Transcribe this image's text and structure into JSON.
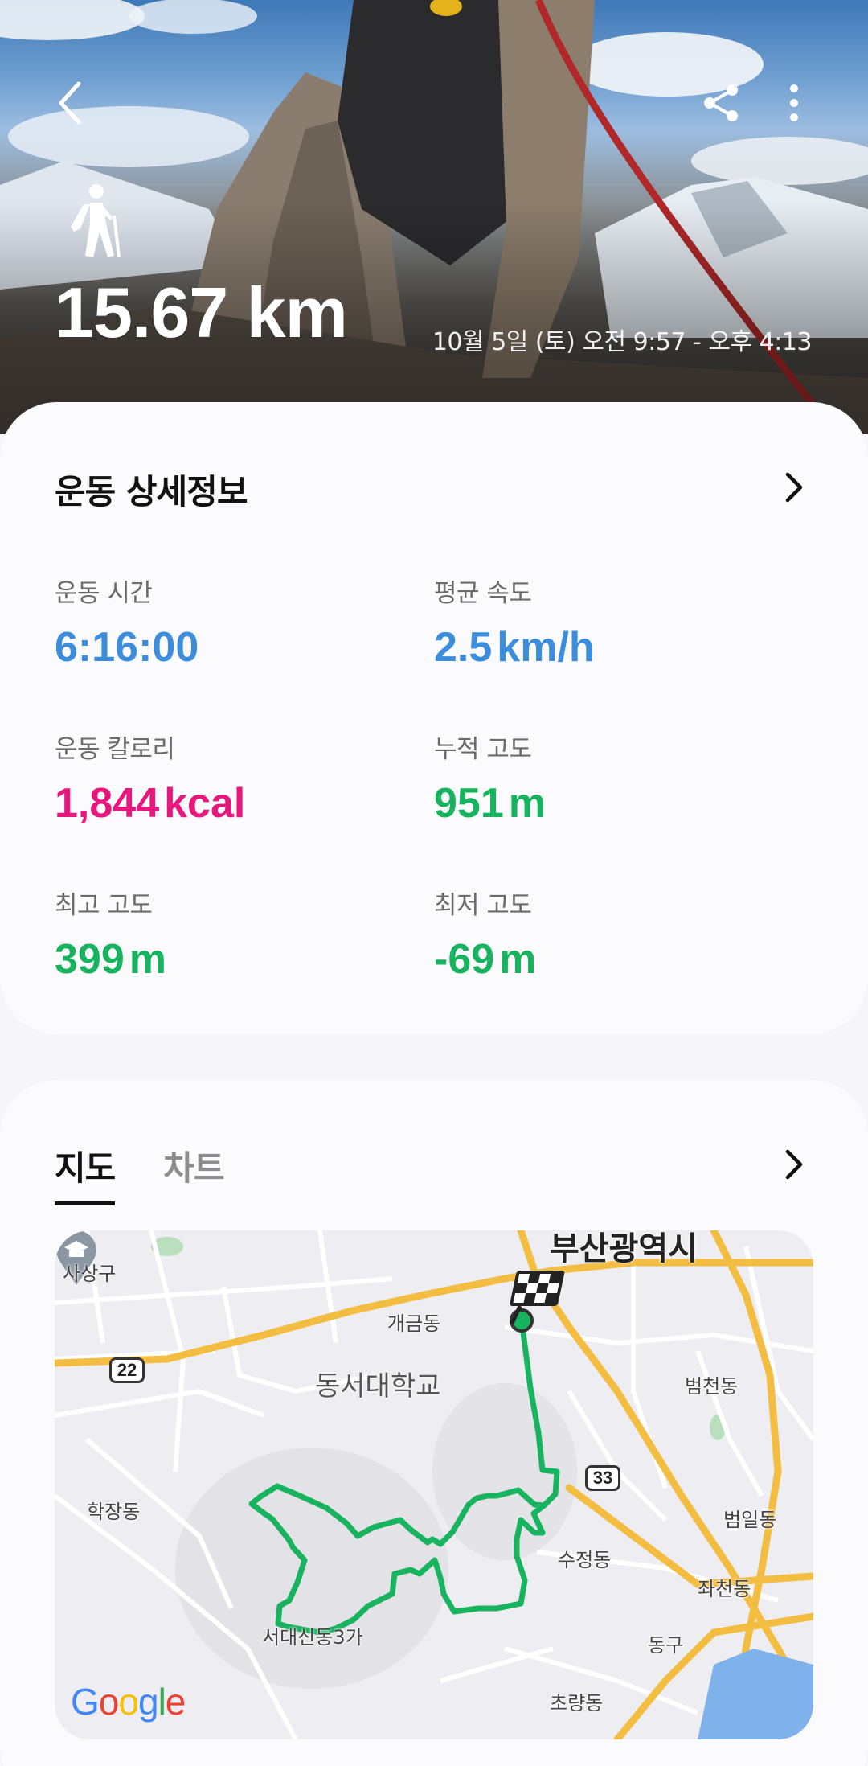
{
  "header": {
    "back_icon": "chevron-left-icon",
    "share_icon": "share-icon",
    "more_icon": "more-vertical-icon",
    "activity_icon": "hiking-icon",
    "distance": "15.67 km",
    "date_range": "10월 5일 (토) 오전 9:57 - 오후 4:13"
  },
  "details": {
    "title": "운동 상세정보",
    "stats": [
      {
        "label": "운동 시간",
        "value": "6:16:00",
        "unit": "",
        "color": "#3d8ddd"
      },
      {
        "label": "평균 속도",
        "value": "2.5",
        "unit": "km/h",
        "color": "#3d8ddd"
      },
      {
        "label": "운동 칼로리",
        "value": "1,844",
        "unit": "kcal",
        "color": "#e8177e"
      },
      {
        "label": "누적 고도",
        "value": "951",
        "unit": "m",
        "color": "#18b35f"
      },
      {
        "label": "최고 고도",
        "value": "399",
        "unit": "m",
        "color": "#18b35f"
      },
      {
        "label": "최저 고도",
        "value": "-69",
        "unit": "m",
        "color": "#18b35f"
      }
    ]
  },
  "map_section": {
    "tabs": [
      {
        "label": "지도",
        "active": true
      },
      {
        "label": "차트",
        "active": false
      }
    ],
    "map_labels": {
      "city": "부산광역시",
      "sasang": "사상구",
      "gaegeum": "개금동",
      "university": "동서대학교",
      "beomcheon": "범천동",
      "hakjang": "학장동",
      "beomil": "범일동",
      "sujeong": "수정동",
      "jwacheon": "좌천동",
      "seodaesin": "서대신동3가",
      "donggu": "동구",
      "choryang": "초량동"
    },
    "route_badges": {
      "r22": "22",
      "r33": "33"
    },
    "route_color": "#18b35f",
    "attribution": "Google"
  }
}
